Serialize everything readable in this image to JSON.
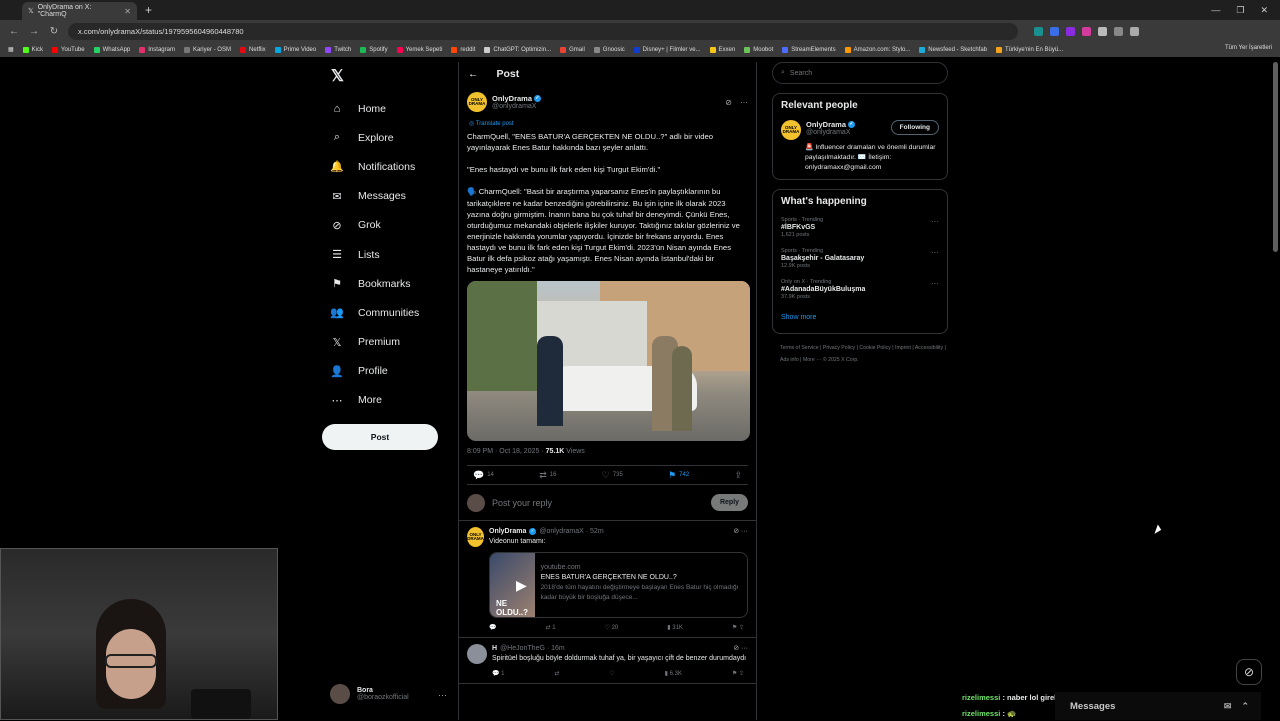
{
  "browser": {
    "tab_title": "OnlyDrama on X: \"CharmQ",
    "url": "x.com/onlydramaX/status/1979595604960448780",
    "bookmarks": [
      {
        "label": "Kick",
        "color": "#53fc18"
      },
      {
        "label": "YouTube",
        "color": "#ff0000"
      },
      {
        "label": "WhatsApp",
        "color": "#25d366"
      },
      {
        "label": "Instagram",
        "color": "#e1306c"
      },
      {
        "label": "Kariyer - OSM",
        "color": "#777777"
      },
      {
        "label": "Netflix",
        "color": "#e50914"
      },
      {
        "label": "Prime Video",
        "color": "#00a8e1"
      },
      {
        "label": "Twitch",
        "color": "#9146ff"
      },
      {
        "label": "Spotify",
        "color": "#1db954"
      },
      {
        "label": "Yemek Sepeti",
        "color": "#fa0050"
      },
      {
        "label": "reddit",
        "color": "#ff4500"
      },
      {
        "label": "ChatGPT: Optimizin...",
        "color": "#cccccc"
      },
      {
        "label": "Gmail",
        "color": "#ea4335"
      },
      {
        "label": "Gnoosic",
        "color": "#888888"
      },
      {
        "label": "Disney+ | Filmler ve...",
        "color": "#113ccf"
      },
      {
        "label": "Exxen",
        "color": "#f5c518"
      },
      {
        "label": "Moobot",
        "color": "#6ac259"
      },
      {
        "label": "StreamElements",
        "color": "#4d6bfe"
      },
      {
        "label": "Amazon.com: Stylo...",
        "color": "#ff9900"
      },
      {
        "label": "Newsfeed - Sketchfab",
        "color": "#1caad9"
      },
      {
        "label": "Türkiye'nin En Büyü...",
        "color": "#f7a21b"
      }
    ],
    "bookmarks_right": "Tüm Yer İşaretleri"
  },
  "nav": {
    "items": [
      {
        "label": "Home",
        "icon": "home-icon",
        "glyph": "⌂"
      },
      {
        "label": "Explore",
        "icon": "search-icon",
        "glyph": "⌕"
      },
      {
        "label": "Notifications",
        "icon": "bell-icon",
        "glyph": "🔔"
      },
      {
        "label": "Messages",
        "icon": "mail-icon",
        "glyph": "✉"
      },
      {
        "label": "Grok",
        "icon": "grok-icon",
        "glyph": "⊘"
      },
      {
        "label": "Lists",
        "icon": "list-icon",
        "glyph": "☰"
      },
      {
        "label": "Bookmarks",
        "icon": "bookmark-icon",
        "glyph": "⚑"
      },
      {
        "label": "Communities",
        "icon": "communities-icon",
        "glyph": "👥"
      },
      {
        "label": "Premium",
        "icon": "x-premium-icon",
        "glyph": "𝕏"
      },
      {
        "label": "Profile",
        "icon": "profile-icon",
        "glyph": "👤"
      },
      {
        "label": "More",
        "icon": "more-circle-icon",
        "glyph": "⋯"
      }
    ],
    "post_button": "Post",
    "account_name": "Bora",
    "account_handle": "@boraozkofficial"
  },
  "post": {
    "header": "Post",
    "author": "OnlyDrama",
    "handle": "@onlydramaX",
    "translate": "Translate post",
    "body": "CharmQuell, \"ENES BATUR'A GERÇEKTEN NE OLDU..?\" adlı bir video yayınlayarak Enes Batur hakkında bazı şeyler anlattı.\n\n\"Enes hastaydı ve bunu ilk fark eden kişi Turgut Ekim'di.\"\n\n🗣️ CharmQuell: \"Basit bir araştırma yaparsanız Enes'in paylaştıklarının bu tarikatçıklere ne kadar benzediğini görebilirsiniz. Bu işin içine ilk olarak 2023 yazına doğru girmiştim. İnanın bana bu çok tuhaf bir deneyimdi. Çünkü Enes, oturduğumuz mekandaki objelerle ilişkiler kuruyor. Taktığınız takılar gözleriniz ve enerjinizle hakkında yorumlar yapıyordu. İçinizde bir frekans arıyordu. Enes hastaydı ve bunu ilk fark eden kişi Turgut Ekim'di. 2023'ün Nisan ayında Enes Batur ilk defa psikoz atağı yaşamıştı. Enes Nisan ayında İstanbul'daki bir hastaneye yatırıldı.\"",
    "time": "8:09 PM · Oct 18, 2025 · ",
    "views": "75.1K",
    "views_label": " Views",
    "replies": "14",
    "reposts": "16",
    "likes": "735",
    "bookmarks": "742",
    "reply_placeholder": "Post your reply",
    "reply_button": "Reply"
  },
  "replies": [
    {
      "author": "OnlyDrama",
      "meta": "@onlydramaX · 52m",
      "text": "Videonun tamamı:",
      "card_domain": "youtube.com",
      "card_title": "ENES BATUR'A GERÇEKTEN NE OLDU..?",
      "card_desc": "2018'de tüm hayatını değiştirmeye başlayan Enes Batur hiç olmadığı kadar büyük bir boşluğa düşece...",
      "card_overlay": "NE OLDU..?",
      "replies": "",
      "reposts": "1",
      "likes": "20",
      "views": "31K"
    },
    {
      "author": "H",
      "meta": "@HeJonTheG · 16m",
      "text": "Spiritüel boşluğu böyle doldurmak tuhaf ya, bir yaşayıcı çift de benzer durumdaydı",
      "replies": "1",
      "views": "6.3K"
    }
  ],
  "right": {
    "search_placeholder": "Search",
    "relevant_title": "Relevant people",
    "person_name": "OnlyDrama",
    "person_handle": "@onlydramaX",
    "follow_label": "Following",
    "person_bio": "🚨 Influencer dramaları ve önemli durumlar paylaşılmaktadır. ✉️ İletişim: onlydramaxx@gmail.com",
    "happening_title": "What's happening",
    "trends": [
      {
        "category": "Sports · Trending",
        "name": "#İBFKvGS",
        "posts": "1,621 posts"
      },
      {
        "category": "Sports · Trending",
        "name": "Başakşehir - Galatasaray",
        "posts": "12.9K posts"
      },
      {
        "category": "Only on X · Trending",
        "name": "#AdanadaBüyükBuluşma",
        "posts": "37.9K posts"
      }
    ],
    "show_more": "Show more",
    "footer": "Terms of Service  |  Privacy Policy  |  Cookie Policy  |  Imprint  |  Accessibility  |  Ads info  |  More ···  © 2025 X Corp."
  },
  "overlay": {
    "chat": [
      {
        "user": "rizelimessi",
        "text": " : naber lol girekmı"
      },
      {
        "user": "rizelimessi",
        "text": " : 🐢"
      }
    ],
    "messages_dock": "Messages"
  }
}
